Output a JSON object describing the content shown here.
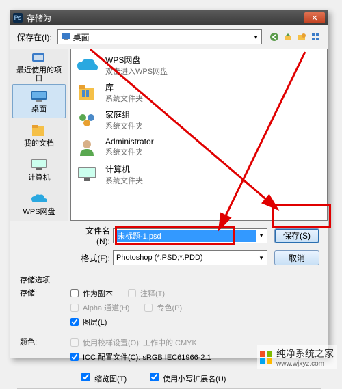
{
  "dialog": {
    "title": "存储为",
    "close_glyph": "✕"
  },
  "topbar": {
    "save_in_label": "保存在(I):",
    "location": "桌面",
    "nav": {
      "back": "arrow-left",
      "up": "arrow-up",
      "new": "folder-star",
      "views": "grid"
    }
  },
  "places": [
    {
      "id": "recent",
      "label": "最近使用的项目"
    },
    {
      "id": "desktop",
      "label": "桌面",
      "selected": true
    },
    {
      "id": "documents",
      "label": "我的文档"
    },
    {
      "id": "computer",
      "label": "计算机"
    },
    {
      "id": "wps",
      "label": "WPS网盘"
    }
  ],
  "files": [
    {
      "name": "WPS网盘",
      "sub": "双击进入WPS网盘",
      "icon": "cloud"
    },
    {
      "name": "库",
      "sub": "系统文件夹",
      "icon": "libraries"
    },
    {
      "name": "家庭组",
      "sub": "系统文件夹",
      "icon": "homegroup"
    },
    {
      "name": "Administrator",
      "sub": "系统文件夹",
      "icon": "user"
    },
    {
      "name": "计算机",
      "sub": "系统文件夹",
      "icon": "computer"
    }
  ],
  "filename": {
    "label": "文件名(N):",
    "value": "未标题-1.psd"
  },
  "format": {
    "label": "格式(F):",
    "value": "Photoshop (*.PSD;*.PDD)"
  },
  "buttons": {
    "save": "保存(S)",
    "cancel": "取消"
  },
  "options": {
    "section": "存储选项",
    "storage_label": "存储:",
    "copy": "作为副本",
    "notes": "注释(T)",
    "alpha": "Alpha 通道(H)",
    "spot": "专色(P)",
    "layers": "图层(L)",
    "color_label": "颜色:",
    "cmyk": "使用校样设置(O): 工作中的 CMYK",
    "icc": "ICC 配置文件(C): sRGB IEC61966-2.1",
    "thumbnail": "缩览图(T)",
    "lowercase": "使用小写扩展名(U)"
  },
  "watermark": {
    "text": "纯净系统之家",
    "url": "www.wjxyz.com"
  }
}
